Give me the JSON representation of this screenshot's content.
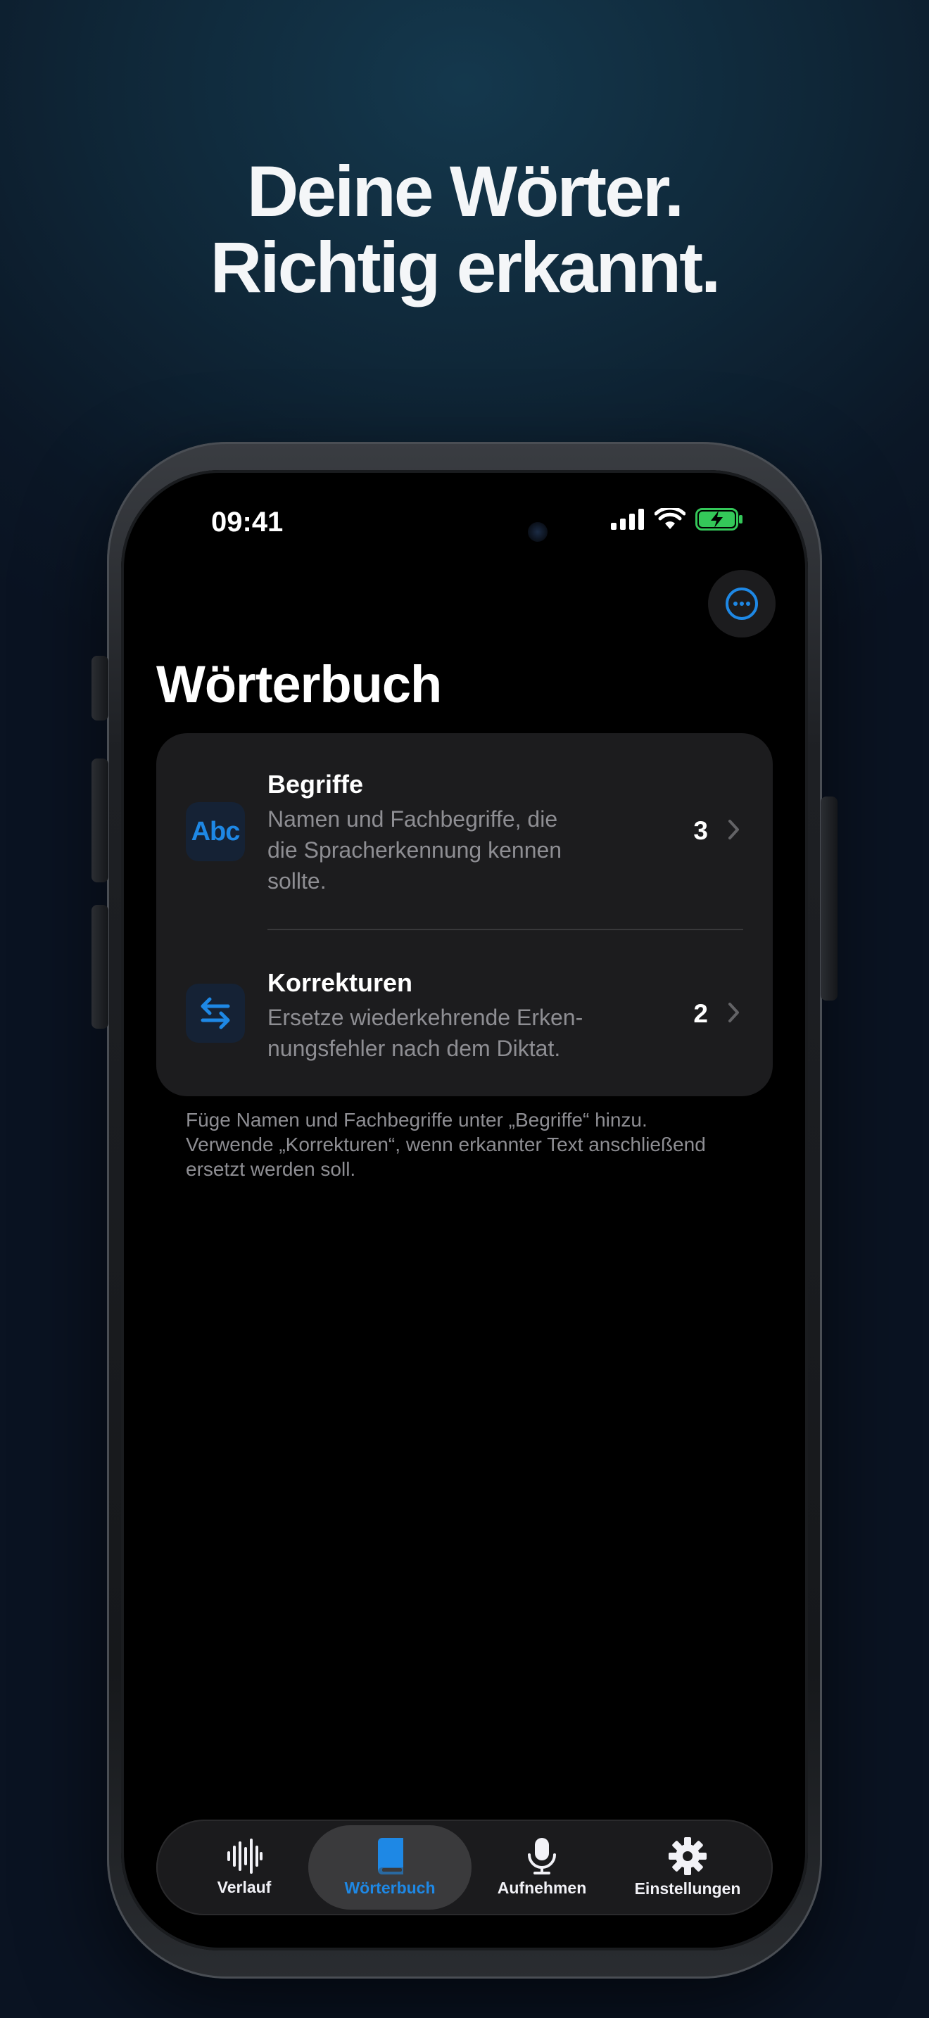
{
  "headline": {
    "line1": "Deine Wörter.",
    "line2": "Richtig erkannt."
  },
  "status_bar": {
    "time": "09:41"
  },
  "screen": {
    "title": "Wörterbuch",
    "more_button": "more-options",
    "rows": [
      {
        "title": "Begriffe",
        "subtitle_lines": [
          "Namen und Fachbegriffe, die",
          "die Spracherkennung kennen",
          "sollte."
        ],
        "icon_text": "Abc",
        "count": "3"
      },
      {
        "title": "Korrekturen",
        "subtitle_lines": [
          "Ersetze wiederkehrende Erken-",
          "nungsfehler nach dem Diktat."
        ],
        "count": "2"
      }
    ],
    "footer_lines": [
      "Füge Namen und Fachbegriffe unter „Begriffe“ hinzu.",
      "Verwende „Korrekturen“, wenn erkannter Text anschließend",
      "ersetzt werden soll."
    ]
  },
  "tabbar": {
    "tabs": [
      {
        "label": "Verlauf",
        "icon": "waveform-icon"
      },
      {
        "label": "Wörterbuch",
        "icon": "book-icon",
        "active": true
      },
      {
        "label": "Aufnehmen",
        "icon": "microphone-icon"
      },
      {
        "label": "Einstellungen",
        "icon": "gear-icon"
      }
    ]
  },
  "colors": {
    "accent": "#1E88E5",
    "background": "#000000",
    "card": "#1C1C1E",
    "secondary_text": "#8E8E93"
  }
}
